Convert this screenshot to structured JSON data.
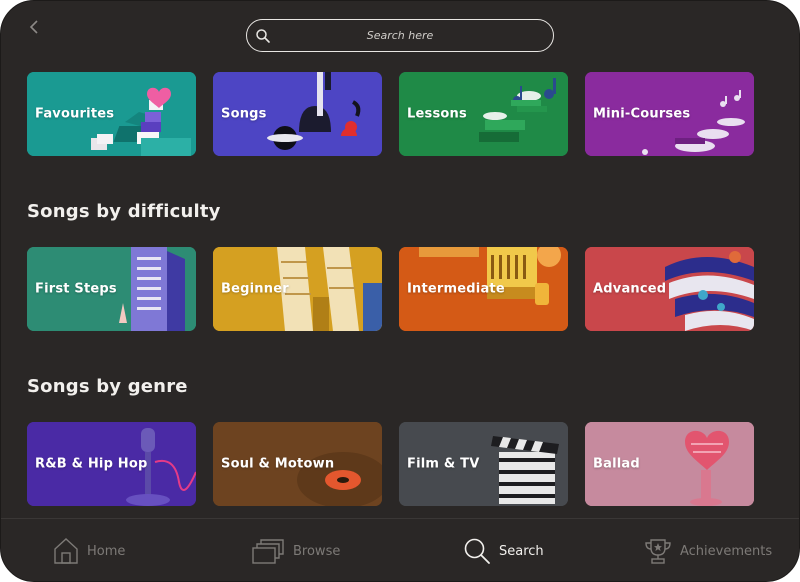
{
  "search": {
    "placeholder": "Search here"
  },
  "top_row": [
    {
      "label": "Favourites",
      "color": "#1a9a92"
    },
    {
      "label": "Songs",
      "color": "#4d45c4"
    },
    {
      "label": "Lessons",
      "color": "#1f8a47"
    },
    {
      "label": "Mini-Courses",
      "color": "#8a2b9e"
    }
  ],
  "difficulty": {
    "title": "Songs by difficulty",
    "cards": [
      {
        "label": "First Steps",
        "color": "#2d8c74"
      },
      {
        "label": "Beginner",
        "color": "#d5a021"
      },
      {
        "label": "Intermediate",
        "color": "#d45a16"
      },
      {
        "label": "Advanced",
        "color": "#c9474b"
      }
    ]
  },
  "genre": {
    "title": "Songs by genre",
    "cards": [
      {
        "label": "R&B & Hip Hop",
        "color": "#4a2aa5"
      },
      {
        "label": "Soul & Motown",
        "color": "#6d4320"
      },
      {
        "label": "Film & TV",
        "color": "#474a4f"
      },
      {
        "label": "Ballad",
        "color": "#c68a9e"
      }
    ]
  },
  "tabbar": {
    "home": "Home",
    "browse": "Browse",
    "search": "Search",
    "achievements": "Achievements"
  }
}
